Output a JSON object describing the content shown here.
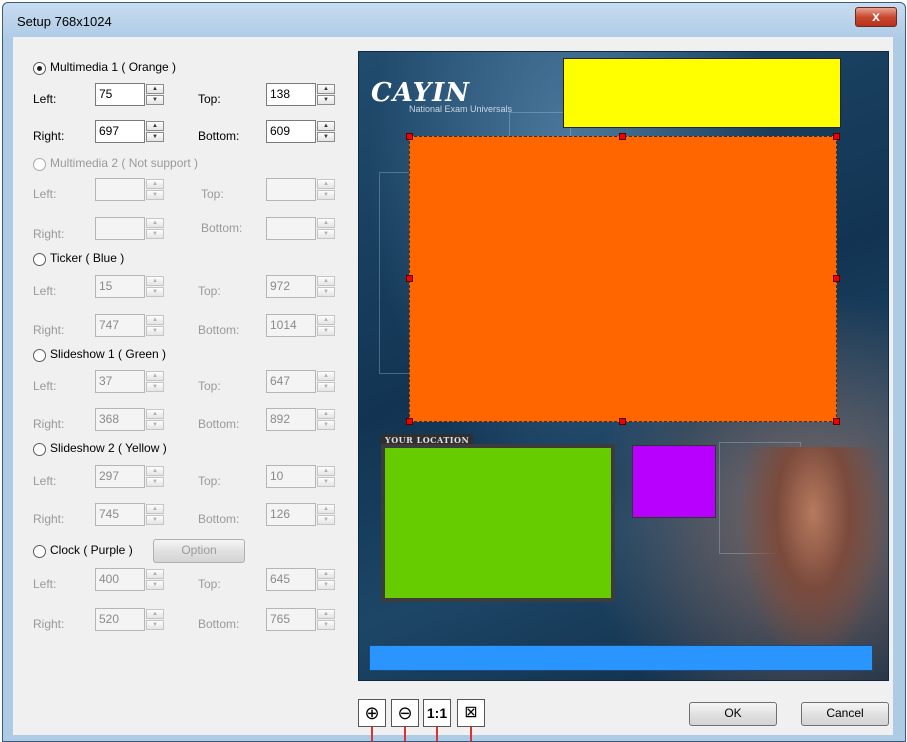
{
  "window": {
    "title": "Setup 768x1024",
    "close_label": "x"
  },
  "sections": {
    "multimedia1": {
      "label": "Multimedia 1 ( Orange )",
      "left_label": "Left:",
      "top_label": "Top:",
      "right_label": "Right:",
      "bottom_label": "Bottom:",
      "left": "75",
      "top": "138",
      "right": "697",
      "bottom": "609",
      "selected": true,
      "enabled": true
    },
    "multimedia2": {
      "label": "Multimedia 2 ( Not support )",
      "left_label": "Left:",
      "top_label": "Top:",
      "right_label": "Right:",
      "bottom_label": "Bottom:",
      "left": "",
      "top": "",
      "right": "",
      "bottom": "",
      "selected": false,
      "enabled": false
    },
    "ticker": {
      "label": "Ticker ( Blue )",
      "left_label": "Left:",
      "top_label": "Top:",
      "right_label": "Right:",
      "bottom_label": "Bottom:",
      "left": "15",
      "top": "972",
      "right": "747",
      "bottom": "1014",
      "selected": false
    },
    "slideshow1": {
      "label": "Slideshow 1 ( Green )",
      "left_label": "Left:",
      "top_label": "Top:",
      "right_label": "Right:",
      "bottom_label": "Bottom:",
      "left": "37",
      "top": "647",
      "right": "368",
      "bottom": "892",
      "selected": false
    },
    "slideshow2": {
      "label": "Slideshow 2 ( Yellow )",
      "left_label": "Left:",
      "top_label": "Top:",
      "right_label": "Right:",
      "bottom_label": "Bottom:",
      "left": "297",
      "top": "10",
      "right": "745",
      "bottom": "126",
      "selected": false
    },
    "clock": {
      "label": "Clock ( Purple )",
      "option_label": "Option",
      "left_label": "Left:",
      "top_label": "Top:",
      "right_label": "Right:",
      "bottom_label": "Bottom:",
      "left": "400",
      "top": "645",
      "right": "520",
      "bottom": "765",
      "selected": false
    }
  },
  "preview": {
    "logo_text": "CAYIN",
    "logo_subtitle": "National Exam Universals",
    "location_tag": "YOUR LOCATION",
    "zone_colors": {
      "orange": "#ff6600",
      "yellow": "#ffff00",
      "green": "#66cc00",
      "purple": "#b800ff",
      "blue": "#2b95ff"
    }
  },
  "toolbar": {
    "zoom_in_icon": "zoom-in-icon",
    "zoom_out_icon": "zoom-out-icon",
    "actual_size_label": "1:1",
    "fit_icon": "fit-window-icon"
  },
  "buttons": {
    "ok": "OK",
    "cancel": "Cancel"
  }
}
